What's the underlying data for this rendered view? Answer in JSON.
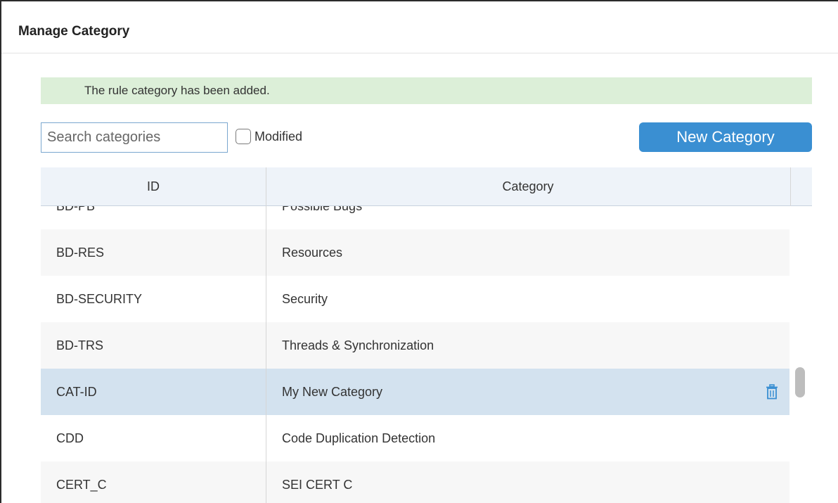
{
  "dialog": {
    "title": "Manage Category"
  },
  "alert": {
    "message": "The rule category has been added."
  },
  "toolbar": {
    "search_placeholder": "Search categories",
    "modified_label": "Modified",
    "new_category_label": "New Category"
  },
  "table": {
    "columns": [
      "ID",
      "Category"
    ],
    "rows": [
      {
        "id": "BD-PB",
        "category": "Possible Bugs"
      },
      {
        "id": "BD-RES",
        "category": "Resources"
      },
      {
        "id": "BD-SECURITY",
        "category": "Security"
      },
      {
        "id": "BD-TRS",
        "category": "Threads & Synchronization"
      },
      {
        "id": "CAT-ID",
        "category": "My New Category"
      },
      {
        "id": "CDD",
        "category": "Code Duplication Detection"
      },
      {
        "id": "CERT_C",
        "category": "SEI CERT C"
      }
    ],
    "selected_row_icon": "trash-icon"
  },
  "colors": {
    "accent": "#3a8fd2",
    "alert_bg": "#dcefd8",
    "header_bg": "#eef3f9",
    "selected_row": "#d3e2ef"
  }
}
